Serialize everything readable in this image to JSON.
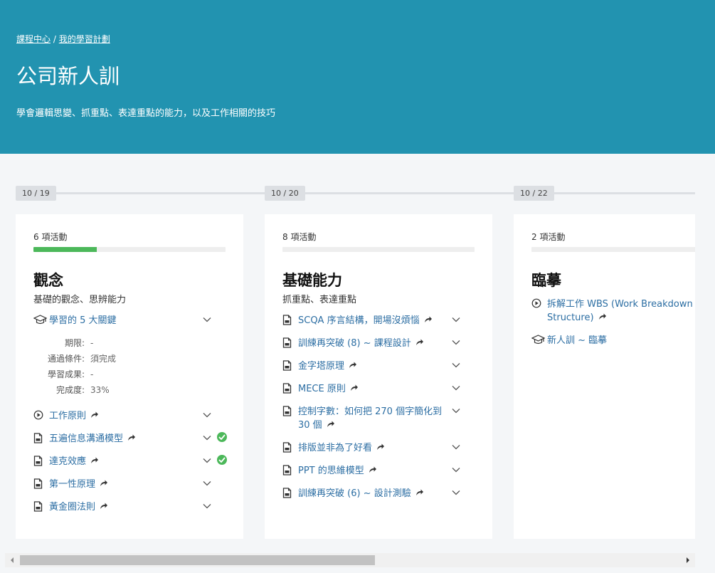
{
  "breadcrumb": {
    "home": "課程中心",
    "separator": "/",
    "current": "我的學習計劃"
  },
  "title": "公司新人訓",
  "description": "學會邏輯思變、抓重點、表達重點的能力，以及工作相關的技巧",
  "colors": {
    "header_bg": "#2293b0",
    "progress_fill": "#4cb85a",
    "link": "#2c6ea3",
    "check": "#4cb85a"
  },
  "timeline": {
    "dates": [
      "10 / 19",
      "10 / 20",
      "10 / 22"
    ]
  },
  "columns": [
    {
      "activity_count": "6 項活動",
      "progress": 0.33,
      "title": "觀念",
      "subtitle": "基礎的觀念、思辨能力",
      "items": [
        {
          "icon": "graduation-cap-icon",
          "label": "學習的 5 大關鍵",
          "expanded": true,
          "details": [
            {
              "label": "期限:",
              "value": "-"
            },
            {
              "label": "通過條件:",
              "value": "須完成"
            },
            {
              "label": "學習成果:",
              "value": "-"
            },
            {
              "label": "完成度:",
              "value": "33%"
            }
          ]
        },
        {
          "icon": "play-circle-icon",
          "label": "工作原則",
          "share": true
        },
        {
          "icon": "document-icon",
          "label": "五遍信息溝通模型",
          "share": true,
          "completed": true
        },
        {
          "icon": "document-icon",
          "label": "達克效應",
          "share": true,
          "completed": true
        },
        {
          "icon": "document-icon",
          "label": "第一性原理",
          "share": true
        },
        {
          "icon": "document-icon",
          "label": "黃金圈法則",
          "share": true
        }
      ]
    },
    {
      "activity_count": "8 項活動",
      "progress": 0,
      "title": "基礎能力",
      "subtitle": "抓重點、表達重點",
      "items": [
        {
          "icon": "document-icon",
          "label": "SCQA 序言結構，開場沒煩惱",
          "share": true
        },
        {
          "icon": "document-icon",
          "label": "訓練再突破 (8) ~ 課程設計",
          "share": true
        },
        {
          "icon": "document-icon",
          "label": "金字塔原理",
          "share": true
        },
        {
          "icon": "document-icon",
          "label": "MECE 原則",
          "share": true
        },
        {
          "icon": "document-icon",
          "label": "控制字數：如何把 270 個字簡化到 30 個",
          "share": true
        },
        {
          "icon": "document-icon",
          "label": "排版並非為了好看",
          "share": true
        },
        {
          "icon": "document-icon",
          "label": "PPT 的思維模型",
          "share": true
        },
        {
          "icon": "document-icon",
          "label": "訓練再突破 (6) ~ 設計測驗",
          "share": true
        }
      ]
    },
    {
      "activity_count": "2 項活動",
      "progress": 0,
      "title": "臨摹",
      "subtitle": "",
      "items": [
        {
          "icon": "play-circle-icon",
          "label": "拆解工作 WBS (Work Breakdown Structure)",
          "share": true,
          "no_chevron": true
        },
        {
          "icon": "graduation-cap-icon",
          "label": "新人訓 ~ 臨摹",
          "no_chevron": true
        }
      ]
    }
  ],
  "scrollbar": {
    "thumb_fraction": 0.52
  }
}
